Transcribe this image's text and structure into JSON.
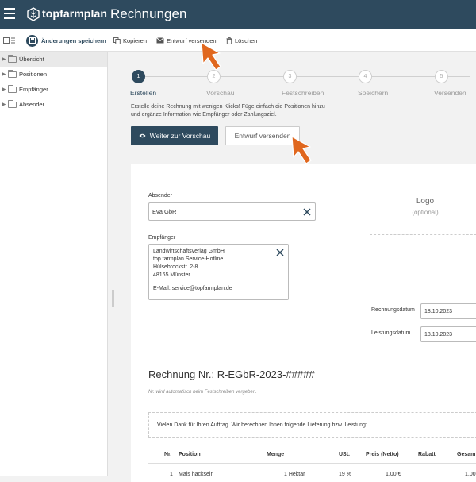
{
  "header": {
    "brand": "topfarmplan",
    "title": "Rechnungen"
  },
  "toolbar": {
    "save_label": "Änderungen speichern",
    "copy_label": "Kopieren",
    "send_draft_label": "Entwurf versenden",
    "delete_label": "Löschen"
  },
  "sidebar": {
    "items": [
      {
        "label": "Übersicht",
        "active": true
      },
      {
        "label": "Positionen",
        "active": false
      },
      {
        "label": "Empfänger",
        "active": false
      },
      {
        "label": "Absender",
        "active": false
      }
    ]
  },
  "stepper": {
    "steps": [
      {
        "number": "1",
        "label": "Erstellen",
        "active": true
      },
      {
        "number": "2",
        "label": "Vorschau",
        "active": false
      },
      {
        "number": "3",
        "label": "Festschreiben",
        "active": false
      },
      {
        "number": "4",
        "label": "Speichern",
        "active": false
      },
      {
        "number": "5",
        "label": "Versenden",
        "active": false
      }
    ]
  },
  "intro": {
    "line1": "Erstelle deine Rechnung mit wenigen Klicks! Füge einfach die Positionen hinzu",
    "line2": "und ergänze Information wie Empfänger oder Zahlungsziel."
  },
  "actions": {
    "preview_label": "Weiter zur Vorschau",
    "send_draft_label": "Entwurf versenden"
  },
  "invoice": {
    "sender_label": "Absender",
    "sender_value": "Eva GbR",
    "recipient_label": "Empfänger",
    "recipient_lines": {
      "l1": "Landwirtschaftsverlag GmbH",
      "l2": "top farmplan Service-Hotline",
      "l3": "Hülsebrockstr. 2-8",
      "l4": "48165 Münster",
      "l5": "E-Mail: service@topfarmplan.de"
    },
    "logo_title": "Logo",
    "logo_sub": "(optional)",
    "invoice_date_label": "Rechnungsdatum",
    "invoice_date_value": "18.10.2023",
    "service_date_label": "Leistungsdatum",
    "service_date_value": "18.10.2023",
    "number_title": "Rechnung Nr.: R-EGbR-2023-#####",
    "number_hint": "Nr. wird automatisch beim Festschreiben vergeben.",
    "intro_text": "Vielen Dank für Ihren Auftrag. Wir berechnen Ihnen folgende Lieferung bzw. Leistung:",
    "table": {
      "headers": {
        "nr": "Nr.",
        "position": "Position",
        "menge": "Menge",
        "ust": "USt.",
        "preis": "Preis (Netto)",
        "rabatt": "Rabatt",
        "gesamt": "Gesam"
      },
      "row1": {
        "nr": "1",
        "position": "Mais häckseln",
        "menge": "1 Hektar",
        "ust": "19 %",
        "preis": "1,00 €",
        "gesamt": "1,00"
      }
    }
  },
  "colors": {
    "brand": "#2e4a5e",
    "arrow": "#e0671e"
  }
}
